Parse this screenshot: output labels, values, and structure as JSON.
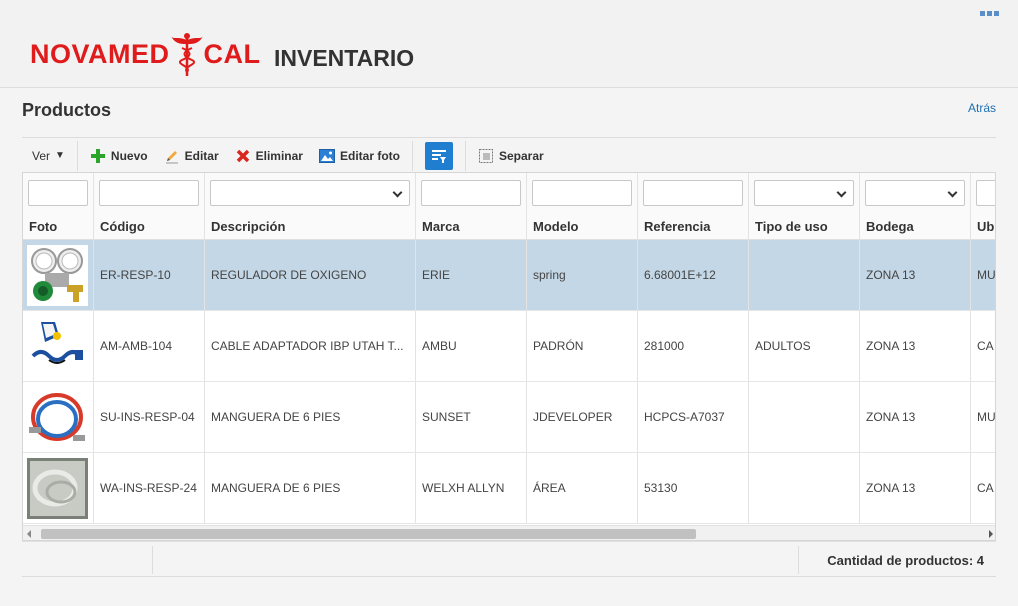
{
  "app": {
    "logo_left": "NOVAMED",
    "logo_right": "CAL",
    "title": "INVENTARIO",
    "brand_color": "#e01b1b"
  },
  "page": {
    "title": "Productos",
    "back_label": "Atrás"
  },
  "toolbar": {
    "view_label": "Ver",
    "new_label": "Nuevo",
    "edit_label": "Editar",
    "delete_label": "Eliminar",
    "edit_photo_label": "Editar foto",
    "detach_label": "Separar"
  },
  "table": {
    "columns": [
      "Foto",
      "Código",
      "Descripción",
      "Marca",
      "Modelo",
      "Referencia",
      "Tipo de uso",
      "Bodega",
      "Ubi"
    ],
    "rows": [
      {
        "codigo": "ER-RESP-10",
        "descripcion": "REGULADOR DE OXIGENO",
        "marca": "ERIE",
        "modelo": "spring",
        "referencia": "6.68001E+12",
        "tipo_uso": "",
        "bodega": "ZONA 13",
        "ubicacion": "MU",
        "photo": "regulator-image",
        "selected": true
      },
      {
        "codigo": "AM-AMB-104",
        "descripcion": "CABLE ADAPTADOR IBP UTAH T...",
        "marca": "AMBU",
        "modelo": "PADRÓN",
        "referencia": "281000",
        "tipo_uso": "ADULTOS",
        "bodega": "ZONA 13",
        "ubicacion": "CA",
        "photo": "cable-image",
        "selected": false
      },
      {
        "codigo": "SU-INS-RESP-04",
        "descripcion": "MANGUERA DE 6 PIES",
        "marca": "SUNSET",
        "modelo": "JDEVELOPER",
        "referencia": "HCPCS-A7037",
        "tipo_uso": "",
        "bodega": "ZONA 13",
        "ubicacion": "MU",
        "photo": "hose-image",
        "selected": false
      },
      {
        "codigo": "WA-INS-RESP-24",
        "descripcion": "MANGUERA DE 6 PIES",
        "marca": "WELXH ALLYN",
        "modelo": "ÁREA",
        "referencia": "53130",
        "tipo_uso": "",
        "bodega": "ZONA 13",
        "ubicacion": "CA",
        "photo": "bag-image",
        "selected": false
      }
    ]
  },
  "footer": {
    "count_text": "Cantidad de productos: 4"
  }
}
